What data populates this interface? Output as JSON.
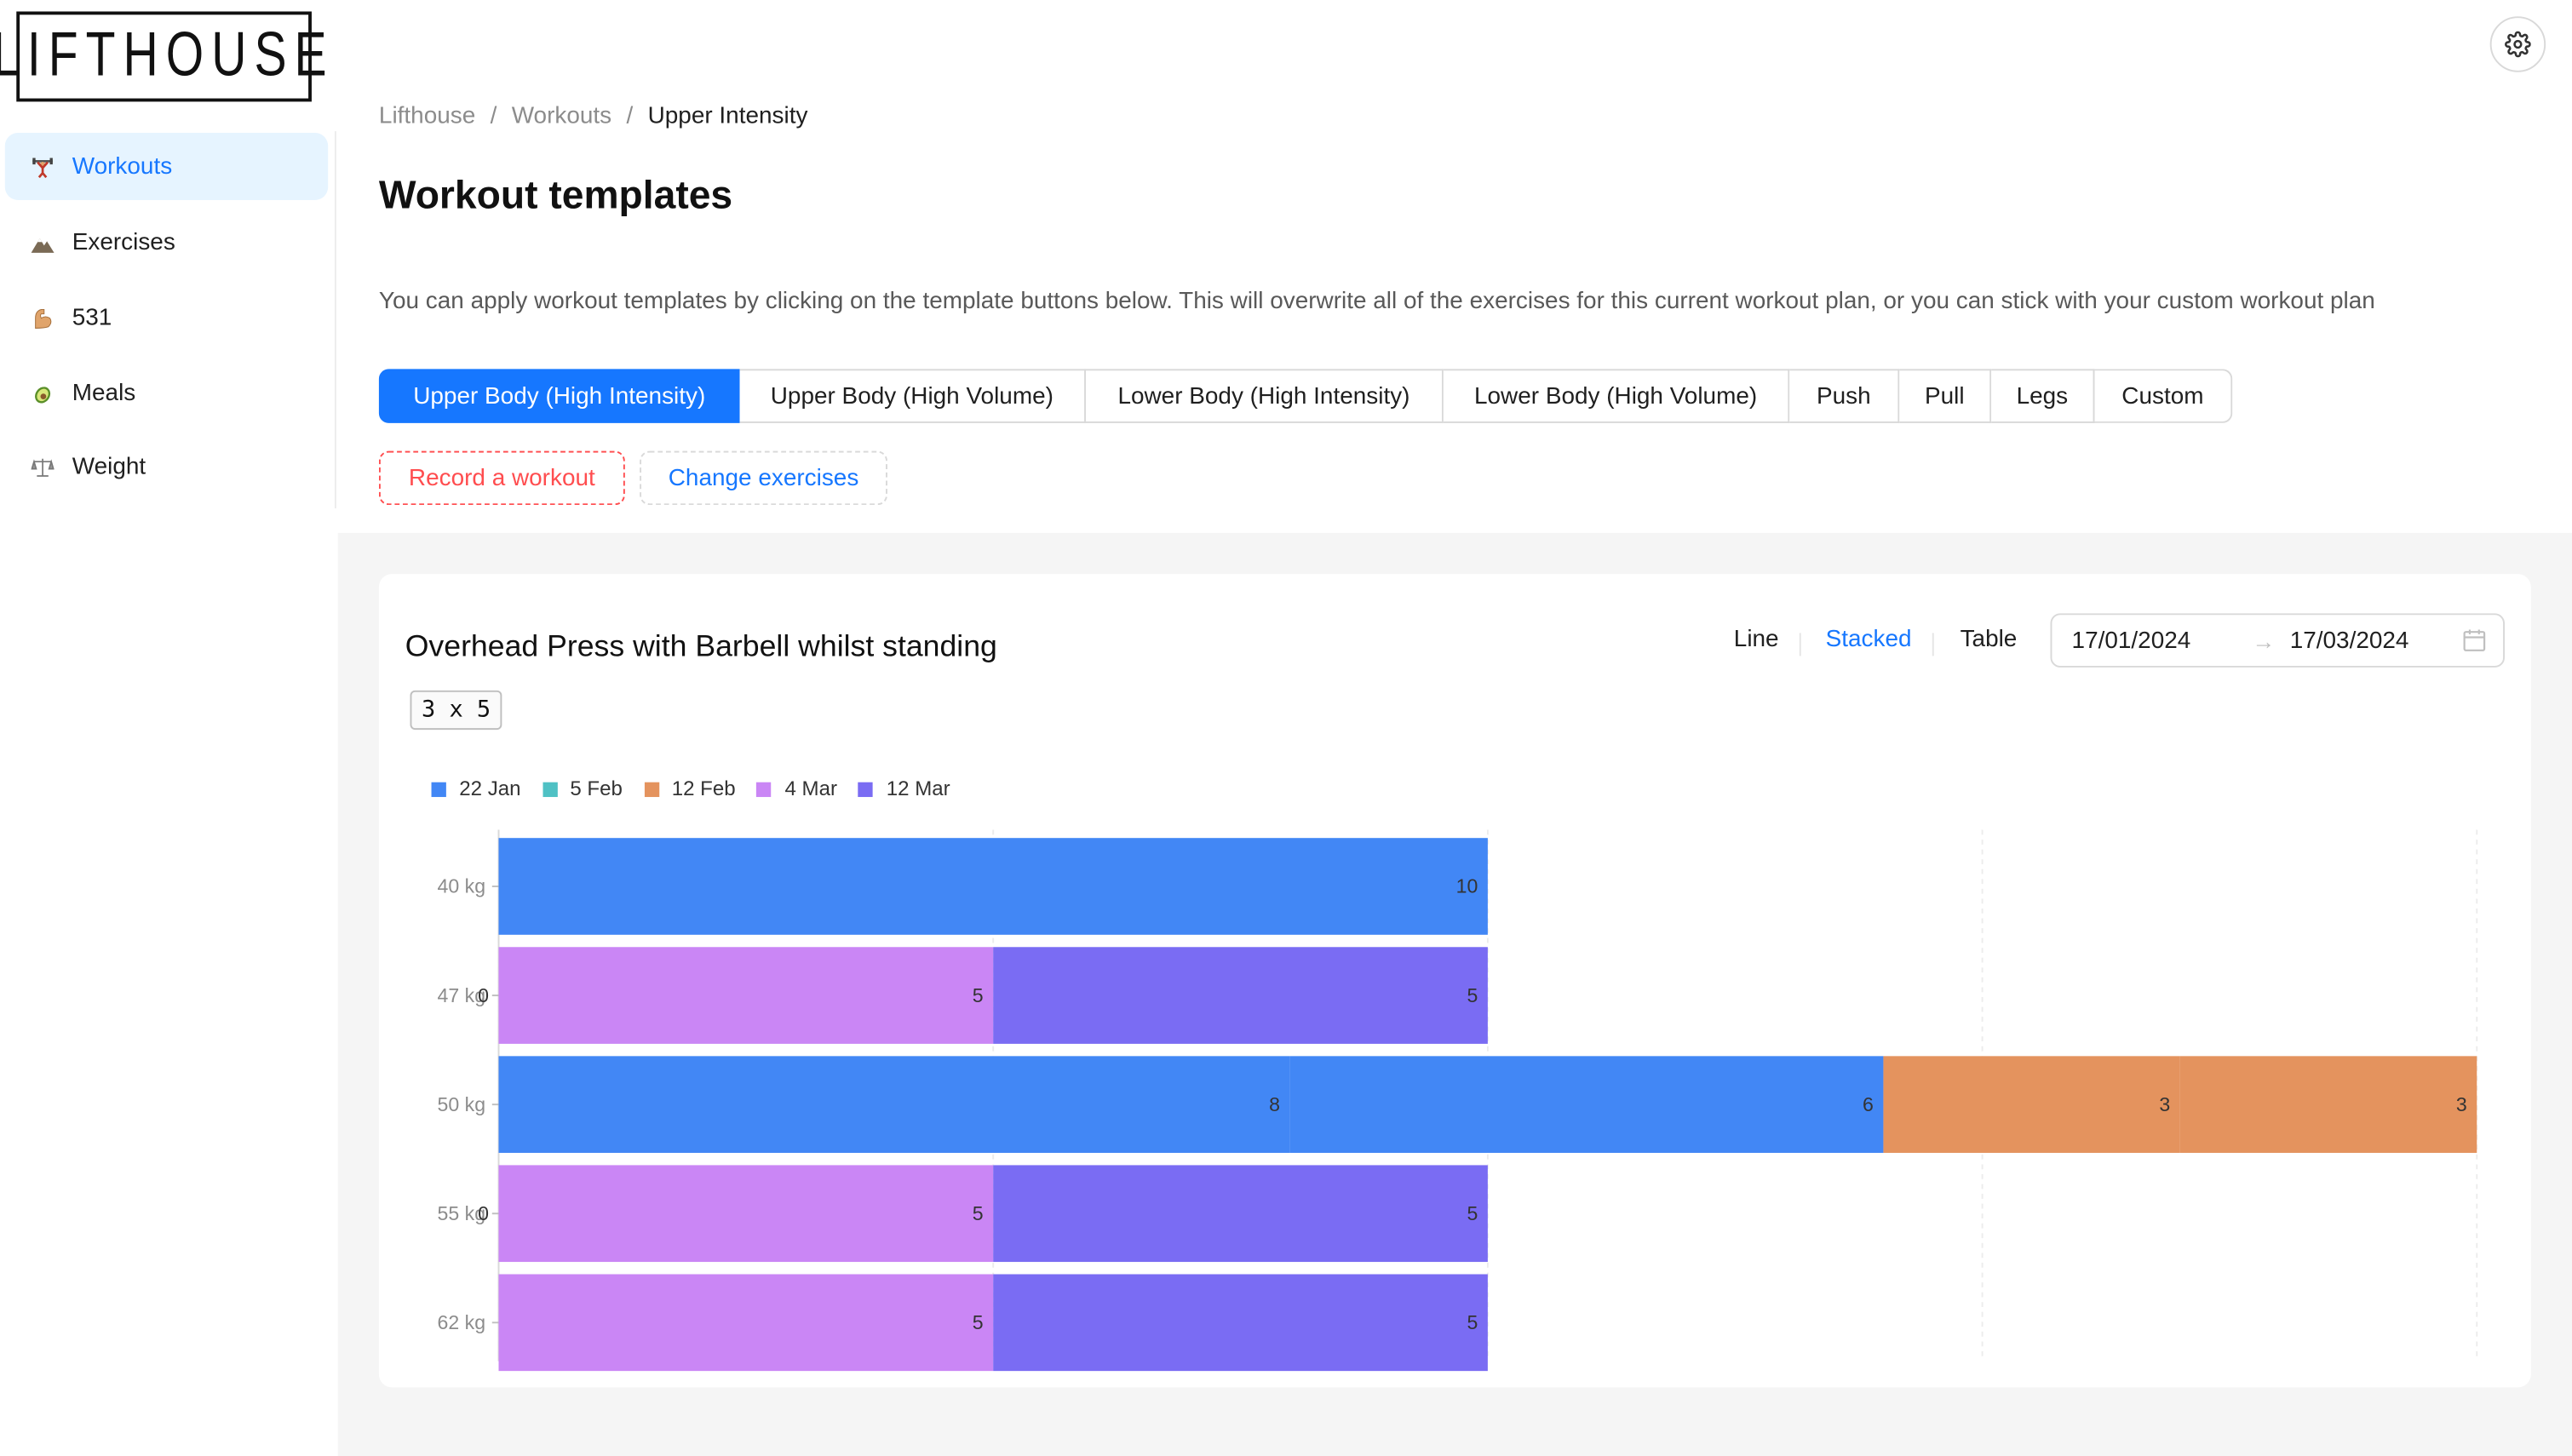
{
  "app": {
    "logo_text": "LIFTHOUSE"
  },
  "sidebar": {
    "items": [
      {
        "label": "Workouts",
        "icon": "weightlifter-icon",
        "active": true
      },
      {
        "label": "Exercises",
        "icon": "mountain-icon",
        "active": false
      },
      {
        "label": "531",
        "icon": "flexed-biceps-icon",
        "active": false
      },
      {
        "label": "Meals",
        "icon": "avocado-icon",
        "active": false
      },
      {
        "label": "Weight",
        "icon": "scale-icon",
        "active": false
      }
    ]
  },
  "header": {
    "settings_icon": "gear-icon"
  },
  "breadcrumb": {
    "items": [
      "Lifthouse",
      "Workouts",
      "Upper Intensity"
    ],
    "separator": "/"
  },
  "page": {
    "title": "Workout templates",
    "description": "You can apply workout templates by clicking on the template buttons below. This will overwrite all of the exercises for this current workout plan, or you can stick with your custom workout plan"
  },
  "templates": {
    "options": [
      "Upper Body (High Intensity)",
      "Upper Body (High Volume)",
      "Lower Body (High Intensity)",
      "Lower Body (High Volume)",
      "Push",
      "Pull",
      "Legs",
      "Custom"
    ],
    "selected": "Upper Body (High Intensity)"
  },
  "actions": {
    "record_label": "Record a workout",
    "change_label": "Change exercises"
  },
  "exercise_card": {
    "title": "Overhead Press with Barbell whilst standing",
    "rep_scheme": "3 x 5",
    "views": [
      "Line",
      "Stacked",
      "Table"
    ],
    "active_view": "Stacked",
    "date_from": "17/01/2024",
    "date_to": "17/03/2024",
    "date_arrow": "→"
  },
  "colors": {
    "accent": "#1677ff",
    "danger": "#ff4d4f",
    "series_22jan": "#4287f5",
    "series_5feb": "#4fc1c4",
    "series_12feb": "#e4935e",
    "series_4mar": "#ca86f5",
    "series_12mar": "#7a6cf3"
  },
  "chart_data": {
    "type": "bar",
    "orientation": "horizontal",
    "stacked": true,
    "categories": [
      "40 kg",
      "47 kg",
      "50 kg",
      "55 kg",
      "62 kg"
    ],
    "series": [
      {
        "name": "22 Jan",
        "color": "#4287f5",
        "segments": [
          [
            10
          ],
          [],
          [
            8,
            6
          ],
          [],
          []
        ]
      },
      {
        "name": "5 Feb",
        "color": "#4fc1c4",
        "segments": [
          [],
          [],
          [],
          [],
          []
        ]
      },
      {
        "name": "12 Feb",
        "color": "#e4935e",
        "segments": [
          [],
          [],
          [
            3,
            3
          ],
          [],
          []
        ]
      },
      {
        "name": "4 Mar",
        "color": "#ca86f5",
        "segments": [
          [],
          [
            0,
            5
          ],
          [],
          [
            0,
            5
          ],
          [
            5
          ]
        ]
      },
      {
        "name": "12 Mar",
        "color": "#7a6cf3",
        "segments": [
          [],
          [
            5
          ],
          [],
          [
            5
          ],
          [
            5
          ]
        ]
      }
    ],
    "xlim": [
      0,
      20
    ],
    "legend_position": "top-left",
    "grid": true
  }
}
